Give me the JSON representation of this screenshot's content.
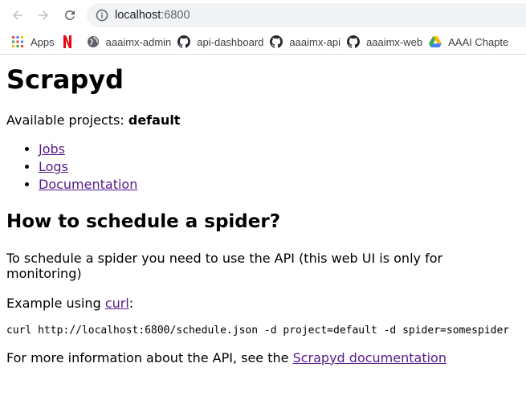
{
  "browser": {
    "url_host": "localhost",
    "url_port": ":6800",
    "icons": {
      "back": "arrow-back-icon",
      "forward": "arrow-forward-icon",
      "reload": "reload-icon",
      "info": "info-icon"
    },
    "bookmarks": [
      {
        "label": "Apps",
        "icon": "apps-grid-icon"
      },
      {
        "label": "",
        "icon": "netflix-icon"
      },
      {
        "label": "aaaimx-admin",
        "icon": "globe-icon"
      },
      {
        "label": "api-dashboard",
        "icon": "github-icon"
      },
      {
        "label": "aaaimx-api",
        "icon": "github-icon"
      },
      {
        "label": "aaaimx-web",
        "icon": "github-icon"
      },
      {
        "label": "AAAI Chapte",
        "icon": "google-drive-icon"
      }
    ]
  },
  "page": {
    "title": "Scrapyd",
    "projects_label": "Available projects: ",
    "projects_value": "default",
    "links": [
      "Jobs",
      "Logs",
      "Documentation"
    ],
    "heading": "How to schedule a spider?",
    "schedule_text": "To schedule a spider you need to use the API (this web UI is only for monitoring)",
    "example_prefix": "Example using ",
    "example_link": "curl",
    "example_suffix": ":",
    "curl_command": "curl http://localhost:6800/schedule.json -d project=default -d spider=somespider",
    "more_prefix": "For more information about the API, see the ",
    "more_link": "Scrapyd documentation"
  },
  "colors": {
    "visited_link": "#551a8b",
    "omnibox_bg": "#f1f3f4",
    "netflix_red": "#e50914"
  }
}
